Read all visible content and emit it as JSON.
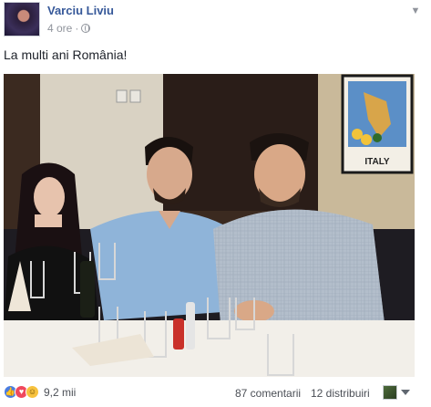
{
  "post": {
    "author": "Varciu Liviu",
    "time": "4 ore",
    "separator": "·",
    "text": "La multi ani România!"
  },
  "photo": {
    "poster_text": "ITALY"
  },
  "footer": {
    "reaction_count": "9,2 mii",
    "comments": "87 comentarii",
    "shares": "12 distribuiri"
  },
  "icons": [
    "globe-icon",
    "chevron-down-icon",
    "like-reaction-icon",
    "love-reaction-icon",
    "haha-reaction-icon",
    "caret-down-icon"
  ]
}
